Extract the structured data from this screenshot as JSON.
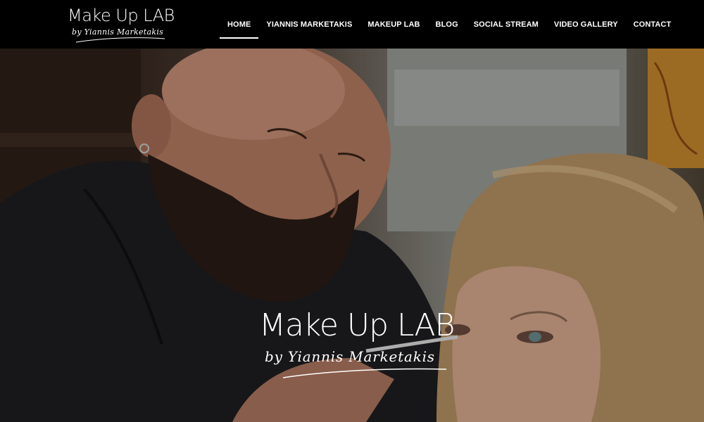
{
  "site": {
    "logo_title": "Make Up LAB",
    "logo_subtitle": "by Yiannis Marketakis"
  },
  "nav": {
    "items": [
      {
        "label": "HOME",
        "active": true
      },
      {
        "label": "YIANNIS MARKETAKIS",
        "active": false
      },
      {
        "label": "MAKEUP LAB",
        "active": false
      },
      {
        "label": "BLOG",
        "active": false
      },
      {
        "label": "SOCIAL STREAM",
        "active": false
      },
      {
        "label": "VIDEO GALLERY",
        "active": false
      },
      {
        "label": "CONTACT",
        "active": false
      }
    ]
  },
  "hero": {
    "logo_title": "Make Up LAB",
    "logo_subtitle": "by Yiannis Marketakis"
  },
  "colors": {
    "header_bg": "#000000",
    "text": "#ffffff"
  }
}
